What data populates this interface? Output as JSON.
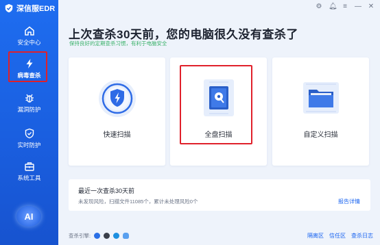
{
  "app": {
    "title": "深信服EDR"
  },
  "window_controls": [
    "gear-icon",
    "bell-icon",
    "menu-icon",
    "minimize-icon",
    "close-icon"
  ],
  "sidebar": {
    "items": [
      {
        "label": "安全中心",
        "icon": "home-icon"
      },
      {
        "label": "病毒查杀",
        "icon": "lightning-icon",
        "active": true
      },
      {
        "label": "漏洞防护",
        "icon": "bug-icon"
      },
      {
        "label": "实时防护",
        "icon": "shield-icon"
      },
      {
        "label": "系统工具",
        "icon": "toolbox-icon"
      }
    ],
    "ai_label": "AI"
  },
  "main": {
    "headline": "上次查杀30天前，您的电脑很久没有查杀了",
    "subline": "保持良好的定期查杀习惯，有利于电脑安全",
    "cards": [
      {
        "label": "快速扫描"
      },
      {
        "label": "全盘扫描"
      },
      {
        "label": "自定义扫描"
      }
    ],
    "summary": {
      "title": "最近一次查杀30天前",
      "desc": "未发现风险，扫描文件11085个，累计未处理风险0个",
      "link": "报告详情"
    }
  },
  "footer": {
    "engine_label": "查杀引擎:",
    "engines": [
      "#2a6fe6",
      "#3a3f4a",
      "#1d8fe0",
      "#5aa0ef"
    ],
    "links": [
      "隔离区",
      "信任区",
      "查杀日志"
    ]
  },
  "colors": {
    "accent": "#1a64f0",
    "sidebar": "#1a5fe0",
    "highlight": "#e0202a",
    "success": "#3bb26a"
  }
}
